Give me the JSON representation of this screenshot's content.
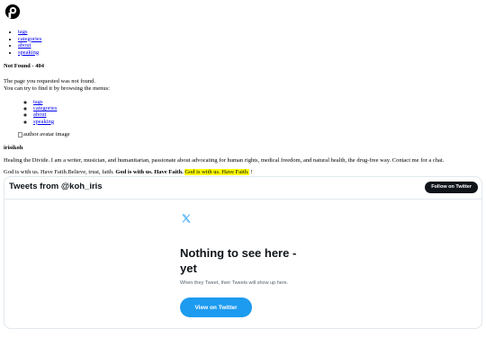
{
  "logo": {
    "icon": "circle-p-logo-icon"
  },
  "nav": {
    "items": [
      {
        "label": "tags"
      },
      {
        "label": "categories"
      },
      {
        "label": "about"
      },
      {
        "label": "speaking"
      }
    ]
  },
  "error": {
    "title": "Not Found - 404",
    "line1": "The page you requested was not found.",
    "line2": "You can try to find it by browsing the menus:"
  },
  "menu2": {
    "items": [
      {
        "label": "tags"
      },
      {
        "label": "categories"
      },
      {
        "label": "about"
      },
      {
        "label": "speaking"
      }
    ]
  },
  "author": {
    "avatar_alt": "author avatar image",
    "name": "irisikoh",
    "bio": "Healing the Divide. I am a writer, musician, and humanitarian, passionate about advocating for human rights, medical freedom, and natural health, the drug-free way. Contact me for a chat.",
    "quote_plain": "God is with us. Have Faith.Believe, trust, faith.",
    "quote_bold": "God is with us. Have Faith.",
    "quote_highlight": "God is with us. Have Faith.",
    "quote_end": "!"
  },
  "twitter": {
    "title": "Tweets from @koh_iris",
    "follow_label": "Follow on Twitter",
    "x_icon": "x-logo-icon",
    "empty_title": "Nothing to see here - yet",
    "empty_sub": "When they Tweet, their Tweets will show up here.",
    "view_label": "View on Twitter",
    "colors": {
      "accent": "#1d9bf0",
      "dark": "#0f1419",
      "border": "#e1e8ed",
      "muted": "#536471"
    }
  }
}
